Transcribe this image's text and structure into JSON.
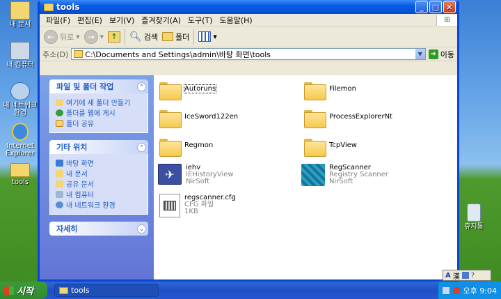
{
  "desktop": {
    "icons": [
      {
        "label": "내 문서"
      },
      {
        "label": "내 컴퓨터"
      },
      {
        "label": "내 네트워크 환경"
      },
      {
        "label": "Internet Explorer"
      },
      {
        "label": "tools"
      },
      {
        "label": "휴지통"
      }
    ]
  },
  "window": {
    "title": "tools",
    "menu": [
      "파일(F)",
      "편집(E)",
      "보기(V)",
      "즐겨찾기(A)",
      "도구(T)",
      "도움말(H)"
    ],
    "toolbar": {
      "back": "뒤로",
      "search": "검색",
      "folders": "폴더"
    },
    "address": {
      "label": "주소(D)",
      "path": "C:\\Documents and Settings\\admin\\바탕 화면\\tools",
      "go": "이동"
    }
  },
  "tasks": {
    "panel1": {
      "title": "파일 및 폴더 작업",
      "items": [
        "여기에 새 폴더 만들기",
        "폴더를 웹에 게시",
        "폴더 공유"
      ]
    },
    "panel2": {
      "title": "기타 위치",
      "items": [
        "바탕 화면",
        "내 문서",
        "공유 문서",
        "내 컴퓨터",
        "내 네트워크 환경"
      ]
    },
    "panel3": {
      "title": "자세히"
    }
  },
  "files": [
    {
      "name": "Autoruns",
      "type": "folder"
    },
    {
      "name": "Filemon",
      "type": "folder"
    },
    {
      "name": "IceSword122en",
      "type": "folder"
    },
    {
      "name": "ProcessExplorerNt",
      "type": "folder"
    },
    {
      "name": "Regmon",
      "type": "folder"
    },
    {
      "name": "TcpView",
      "type": "folder"
    },
    {
      "name": "iehv",
      "sub1": "IEHistoryView",
      "sub2": "NirSoft",
      "type": "app"
    },
    {
      "name": "RegScanner",
      "sub1": "Registry Scanner",
      "sub2": "NirSoft",
      "type": "app"
    },
    {
      "name": "regscanner.cfg",
      "sub1": "CFG 파일",
      "sub2": "1KB",
      "type": "file"
    }
  ],
  "taskbar": {
    "start": "시작",
    "task": "tools",
    "clock": "오후 9:04"
  },
  "ime": {
    "lang": "A",
    "mode": "漢"
  }
}
